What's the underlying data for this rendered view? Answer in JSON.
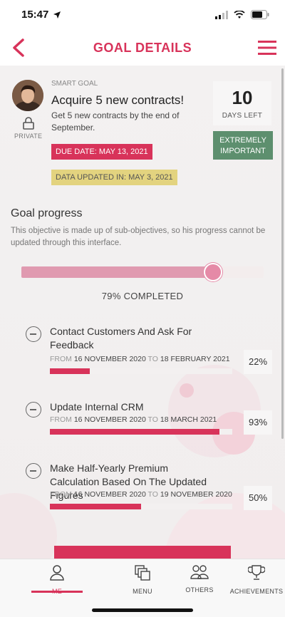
{
  "status": {
    "time": "15:47"
  },
  "header": {
    "title": "GOAL DETAILS"
  },
  "goal": {
    "type_label": "SMART GOAL",
    "title": "Acquire 5 new contracts!",
    "description": "Get 5 new contracts by the end of September.",
    "privacy_label": "PRIVATE",
    "due_date": "DUE DATE: MAY 13, 2021",
    "data_updated": "DATA UPDATED IN: MAY 3, 2021",
    "days_left_value": "10",
    "days_left_label": "DAYS LEFT",
    "priority": "EXTREMELY IMPORTANT"
  },
  "progress": {
    "section_title": "Goal progress",
    "note": "This objective is made up of sub-objectives, so his progress cannot be updated through this interface.",
    "percent": 79,
    "label": "79% COMPLETED"
  },
  "sub_objectives": [
    {
      "title": "Contact Customers And Ask For Feedback",
      "from_kw": "FROM",
      "from": "16 NOVEMBER 2020",
      "to_kw": "TO",
      "to": "18 FEBRUARY 2021",
      "percent_value": 22,
      "percent_label": "22%"
    },
    {
      "title": "Update Internal CRM",
      "from_kw": "FROM",
      "from": "16 NOVEMBER 2020",
      "to_kw": "TO",
      "to": "18 MARCH 2021",
      "percent_value": 93,
      "percent_label": "93%"
    },
    {
      "title": "Make Half-Yearly Premium Calculation Based On The Updated Figures",
      "from_kw": "FROM",
      "from": "16 NOVEMBER 2020",
      "to_kw": "TO",
      "to": "19 NOVEMBER 2020",
      "percent_value": 50,
      "percent_label": "50%"
    }
  ],
  "tabbar": {
    "items": [
      {
        "label": "ME",
        "icon": "person-icon"
      },
      {
        "label": "MENU",
        "icon": "menu-cards-icon"
      },
      {
        "label": "OTHERS",
        "icon": "people-icon"
      },
      {
        "label": "ACHIEVEMENTS",
        "icon": "trophy-icon"
      }
    ]
  },
  "colors": {
    "accent": "#d8335a",
    "priority": "#5d8f6e",
    "updated": "#e3d37f",
    "progress": "#e09ab0"
  }
}
